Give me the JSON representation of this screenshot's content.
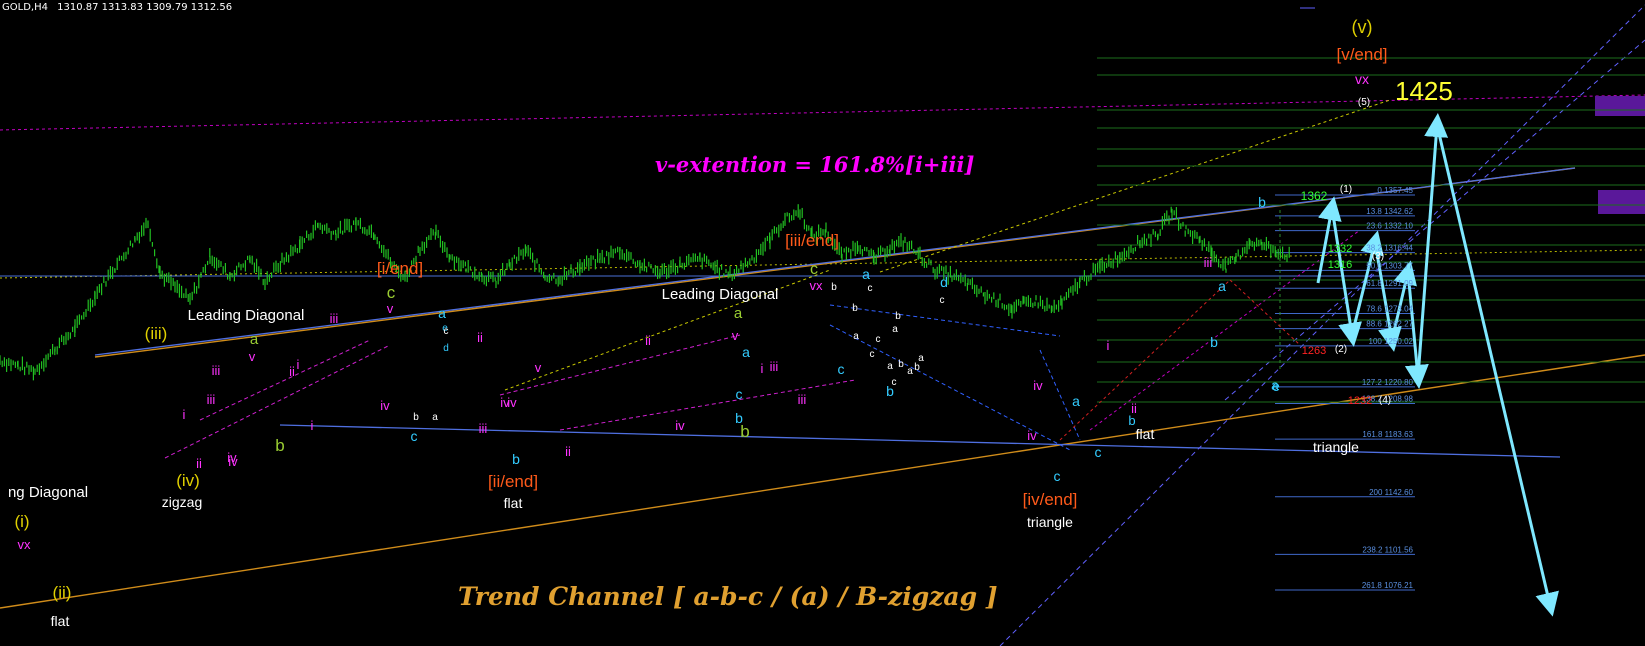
{
  "header": {
    "symbol": "GOLD,H4",
    "quote": "1310.87 1313.83 1309.79 1312.56"
  },
  "extension_text": "v-extention = 161.8%[i+iii]",
  "trend_text": "Trend Channel  [ a-b-c / (a) / B-zigzag ]",
  "target_text": "1425",
  "chart_data": {
    "type": "candlestick",
    "symbol": "GOLD",
    "timeframe": "H4",
    "last_bar": {
      "open": 1310.87,
      "high": 1313.83,
      "low": 1309.79,
      "close": 1312.56
    },
    "ylim": [
      1070,
      1430
    ],
    "grid": false,
    "price_path": [
      [
        0,
        1240
      ],
      [
        18,
        1236
      ],
      [
        35,
        1232
      ],
      [
        55,
        1248
      ],
      [
        75,
        1262
      ],
      [
        95,
        1286
      ],
      [
        115,
        1306
      ],
      [
        135,
        1326
      ],
      [
        148,
        1338
      ],
      [
        160,
        1302
      ],
      [
        175,
        1292
      ],
      [
        190,
        1282
      ],
      [
        210,
        1314
      ],
      [
        230,
        1300
      ],
      [
        250,
        1312
      ],
      [
        265,
        1296
      ],
      [
        282,
        1310
      ],
      [
        300,
        1322
      ],
      [
        318,
        1336
      ],
      [
        336,
        1330
      ],
      [
        356,
        1338
      ],
      [
        375,
        1330
      ],
      [
        392,
        1308
      ],
      [
        405,
        1298
      ],
      [
        420,
        1320
      ],
      [
        436,
        1330
      ],
      [
        450,
        1314
      ],
      [
        466,
        1306
      ],
      [
        482,
        1300
      ],
      [
        496,
        1296
      ],
      [
        510,
        1308
      ],
      [
        526,
        1318
      ],
      [
        545,
        1300
      ],
      [
        560,
        1298
      ],
      [
        580,
        1306
      ],
      [
        600,
        1312
      ],
      [
        620,
        1318
      ],
      [
        640,
        1308
      ],
      [
        660,
        1302
      ],
      [
        680,
        1308
      ],
      [
        700,
        1312
      ],
      [
        715,
        1306
      ],
      [
        730,
        1300
      ],
      [
        752,
        1312
      ],
      [
        770,
        1326
      ],
      [
        785,
        1340
      ],
      [
        800,
        1346
      ],
      [
        812,
        1328
      ],
      [
        826,
        1332
      ],
      [
        842,
        1314
      ],
      [
        858,
        1322
      ],
      [
        874,
        1312
      ],
      [
        890,
        1320
      ],
      [
        905,
        1324
      ],
      [
        920,
        1314
      ],
      [
        935,
        1304
      ],
      [
        952,
        1300
      ],
      [
        968,
        1294
      ],
      [
        985,
        1286
      ],
      [
        1000,
        1282
      ],
      [
        1012,
        1276
      ],
      [
        1024,
        1280
      ],
      [
        1036,
        1282
      ],
      [
        1052,
        1276
      ],
      [
        1062,
        1280
      ],
      [
        1080,
        1296
      ],
      [
        1100,
        1306
      ],
      [
        1120,
        1314
      ],
      [
        1140,
        1324
      ],
      [
        1158,
        1330
      ],
      [
        1172,
        1346
      ],
      [
        1186,
        1332
      ],
      [
        1200,
        1326
      ],
      [
        1212,
        1316
      ],
      [
        1226,
        1306
      ],
      [
        1236,
        1312
      ],
      [
        1250,
        1324
      ],
      [
        1262,
        1322
      ],
      [
        1276,
        1318
      ],
      [
        1290,
        1314
      ]
    ],
    "levels": [
      {
        "label": "0 1357.45",
        "price": 1357.45
      },
      {
        "label": "13.8 1342.62",
        "price": 1342.62
      },
      {
        "label": "23.6 1332.10",
        "price": 1332.1
      },
      {
        "label": "38.2 1316.44",
        "price": 1316.44
      },
      {
        "label": "50.0 1303.77",
        "price": 1303.77
      },
      {
        "label": "61.8 1291.09",
        "price": 1291.09
      },
      {
        "label": "78.6 1273.04",
        "price": 1273.04
      },
      {
        "label": "88.6 1262.27",
        "price": 1262.27
      },
      {
        "label": "100 1250.02",
        "price": 1250.02
      },
      {
        "label": "127.2 1220.80",
        "price": 1220.8
      },
      {
        "label": "138.2 1208.98",
        "price": 1208.98
      },
      {
        "label": "161.8 1183.63",
        "price": 1183.63
      },
      {
        "label": "200 1142.60",
        "price": 1142.6
      },
      {
        "label": "238.2 1101.56",
        "price": 1101.56
      },
      {
        "label": "261.8 1076.21",
        "price": 1076.21
      }
    ],
    "annotations": [
      {
        "text": "(v)",
        "color": "#e0d000"
      },
      {
        "text": "[v/end]",
        "color": "#ff5a1a"
      },
      {
        "text": "vx",
        "color": "#ff33ff"
      },
      {
        "text": "(5)",
        "color": "#ffffff"
      },
      {
        "text": "1362",
        "color": "#33ff33"
      },
      {
        "text": "(1)",
        "color": "#ffffff"
      },
      {
        "text": "1332",
        "color": "#33ff33"
      },
      {
        "text": "1316",
        "color": "#33ff33"
      },
      {
        "text": "(3)",
        "color": "#ffffff"
      },
      {
        "text": "1263",
        "color": "#ff2222"
      },
      {
        "text": "(2)",
        "color": "#ffffff"
      },
      {
        "text": "1232",
        "color": "#ff2222"
      },
      {
        "text": "(4)",
        "color": "#ffffff"
      },
      {
        "text": "Leading Diagonal",
        "color": "#ffffff"
      },
      {
        "text": "Leading Diagonal",
        "color": "#ffffff"
      },
      {
        "text": "ng Diagonal",
        "color": "#ffffff"
      },
      {
        "text": "[i/end]",
        "color": "#ff5a1a"
      },
      {
        "text": "[iii/end]",
        "color": "#ff5a1a"
      },
      {
        "text": "[ii/end]",
        "color": "#ff5a1a"
      },
      {
        "text": "[iv/end]",
        "color": "#ff5a1a"
      },
      {
        "text": "(iii)",
        "color": "#e0d000"
      },
      {
        "text": "(iv)",
        "color": "#e0d000"
      },
      {
        "text": "(i)",
        "color": "#e0d000"
      },
      {
        "text": "(ii)",
        "color": "#e0d000"
      },
      {
        "text": "zigzag",
        "color": "#ffffff"
      },
      {
        "text": "flat",
        "color": "#ffffff"
      },
      {
        "text": "flat",
        "color": "#ffffff"
      },
      {
        "text": "flat",
        "color": "#ffffff"
      },
      {
        "text": "triangle",
        "color": "#ffffff"
      },
      {
        "text": "triangle",
        "color": "#ffffff"
      },
      {
        "text": "c",
        "color": "#9acd32"
      },
      {
        "text": "a",
        "color": "#9acd32"
      },
      {
        "text": "b",
        "color": "#9acd32"
      },
      {
        "text": "c",
        "color": "#9acd32"
      },
      {
        "text": "a",
        "color": "#9acd32"
      },
      {
        "text": "b",
        "color": "#9acd32"
      },
      {
        "text": "vx",
        "color": "#ff33ff"
      },
      {
        "text": "v",
        "color": "#ff33ff"
      },
      {
        "text": "v",
        "color": "#ff33ff"
      },
      {
        "text": "iii",
        "color": "#ff33ff"
      },
      {
        "text": "iii",
        "color": "#ff33ff"
      },
      {
        "text": "iii",
        "color": "#ff33ff"
      },
      {
        "text": "iii",
        "color": "#ff33ff"
      },
      {
        "text": "iv",
        "color": "#ff33ff"
      },
      {
        "text": "iv",
        "color": "#ff33ff"
      },
      {
        "text": "iv",
        "color": "#ff33ff"
      },
      {
        "text": "iv",
        "color": "#ff33ff"
      },
      {
        "text": "iv",
        "color": "#ff33ff"
      },
      {
        "text": "ii",
        "color": "#ff33ff"
      },
      {
        "text": "ii",
        "color": "#ff33ff"
      },
      {
        "text": "ii",
        "color": "#ff33ff"
      },
      {
        "text": "ii",
        "color": "#ff33ff"
      },
      {
        "text": "i",
        "color": "#ff33ff"
      },
      {
        "text": "i",
        "color": "#ff33ff"
      },
      {
        "text": "i",
        "color": "#ff33ff"
      },
      {
        "text": "vx",
        "color": "#ff33ff"
      },
      {
        "text": "v",
        "color": "#ff33ff"
      },
      {
        "text": "iii",
        "color": "#ff33ff"
      },
      {
        "text": "iv",
        "color": "#ff33ff"
      },
      {
        "text": "i",
        "color": "#ff33ff"
      },
      {
        "text": "ii",
        "color": "#ff33ff"
      },
      {
        "text": "v",
        "color": "#ff33ff"
      },
      {
        "text": "iii",
        "color": "#ff33ff"
      },
      {
        "text": "iv",
        "color": "#ff33ff"
      },
      {
        "text": "ii",
        "color": "#ff33ff"
      },
      {
        "text": "i",
        "color": "#ff33ff"
      },
      {
        "text": "iii",
        "color": "#ff33ff"
      },
      {
        "text": "iv",
        "color": "#ff33ff"
      },
      {
        "text": "b",
        "color": "#33ccff"
      },
      {
        "text": "a",
        "color": "#33ccff"
      },
      {
        "text": "c",
        "color": "#33ccff"
      },
      {
        "text": "b",
        "color": "#33ccff"
      },
      {
        "text": "a",
        "color": "#33ccff"
      },
      {
        "text": "c",
        "color": "#33ccff"
      },
      {
        "text": "b",
        "color": "#33ccff"
      },
      {
        "text": "a",
        "color": "#33ccff"
      },
      {
        "text": "c",
        "color": "#33ccff"
      },
      {
        "text": "b",
        "color": "#33ccff"
      },
      {
        "text": "d",
        "color": "#33ccff"
      },
      {
        "text": "a",
        "color": "#33ccff"
      },
      {
        "text": "c",
        "color": "#33ccff"
      },
      {
        "text": "e",
        "color": "#33ccff"
      },
      {
        "text": "b",
        "color": "#33ccff"
      },
      {
        "text": "a",
        "color": "#33ccff"
      },
      {
        "text": "b",
        "color": "#33ccff"
      },
      {
        "text": "a",
        "color": "#33ccff"
      },
      {
        "text": "c",
        "color": "#33ccff"
      },
      {
        "text": "d",
        "color": "#33ccff"
      },
      {
        "text": "e",
        "color": "#33ccff"
      },
      {
        "text": "b",
        "color": "#ffffff"
      },
      {
        "text": "a",
        "color": "#ffffff"
      },
      {
        "text": "c",
        "color": "#ffffff"
      },
      {
        "text": "b",
        "color": "#ffffff"
      },
      {
        "text": "c",
        "color": "#ffffff"
      },
      {
        "text": "b",
        "color": "#ffffff"
      },
      {
        "text": "a",
        "color": "#ffffff"
      },
      {
        "text": "c",
        "color": "#ffffff"
      },
      {
        "text": "a",
        "color": "#ffffff"
      },
      {
        "text": "c",
        "color": "#ffffff"
      },
      {
        "text": "b",
        "color": "#ffffff"
      },
      {
        "text": "c",
        "color": "#ffffff"
      },
      {
        "text": "a",
        "color": "#ffffff"
      },
      {
        "text": "b",
        "color": "#ffffff"
      },
      {
        "text": "c",
        "color": "#ffffff"
      },
      {
        "text": "a",
        "color": "#ffffff"
      },
      {
        "text": "b",
        "color": "#ffffff"
      },
      {
        "text": "a",
        "color": "#ffffff"
      }
    ]
  }
}
